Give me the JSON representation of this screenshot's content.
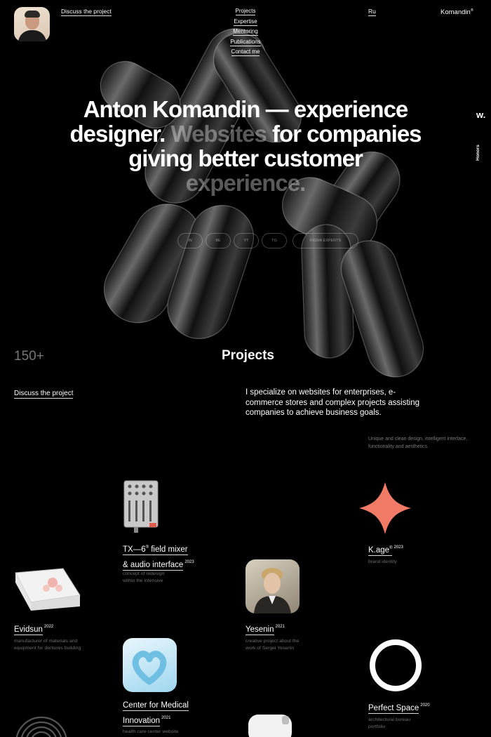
{
  "header": {
    "discuss_link": "Discuss the project",
    "nav": [
      "Projects",
      "Expertise",
      "Mentoring",
      "Publications",
      "Contact me"
    ],
    "lang": "Ru",
    "brand": "Komandin",
    "brand_mark": "®"
  },
  "side": {
    "w_badge": "w.",
    "honors": "Honors"
  },
  "hero": {
    "line1a": "Anton Komandin",
    "line1b": " — experience",
    "line2a": "designer. ",
    "line2b": "Websites",
    "line2c": " for companies",
    "line3": "giving better customer",
    "line4": "experience.",
    "pills": [
      "IN",
      "BE",
      "YT",
      "TG",
      "FIGMA EXPERTS"
    ]
  },
  "stats": {
    "count": "150+",
    "section_title": "Projects",
    "discuss_link": "Discuss the project",
    "intro": "I specialize on websites for enterprises, e- commerce stores and complex projects assisting companies to achieve business goals.",
    "intro_sub": "Unique and clean design, intelligent interface, functionality and aesthetics."
  },
  "projects": [
    {
      "title_l1": "TX—6",
      "title_mark": "®",
      "title_l1b": " field mixer",
      "title_l2": "& audio interface",
      "year": "2023",
      "desc_l1": "concept of redesign",
      "desc_l2": "within the intensive"
    },
    {
      "title_l1": "K.age",
      "title_mark": "®",
      "year": "2023",
      "desc_l1": "brand identity"
    },
    {
      "title_l1": "Evidsun",
      "year": "2022",
      "desc_l1": "manufacturer of materials and",
      "desc_l2": "equipment for dentures building"
    },
    {
      "title_l1": "Yesenin",
      "year": "2021",
      "desc_l1": "creative project about the",
      "desc_l2": "work of Sergei Yesenin"
    },
    {
      "title_l1": "Center for Medical",
      "title_l2": "Innovation",
      "year": "2021",
      "desc_l1": "health care center website"
    },
    {
      "title_l1": "Perfect Space",
      "year": "2020",
      "desc_l1": "architectural bureau",
      "desc_l2": "portfolio"
    }
  ],
  "colors": {
    "background": "#000000",
    "text": "#ffffff",
    "muted": "#777777",
    "kage_star": "#f07a66",
    "medical_blue": "#8fd0ee"
  }
}
